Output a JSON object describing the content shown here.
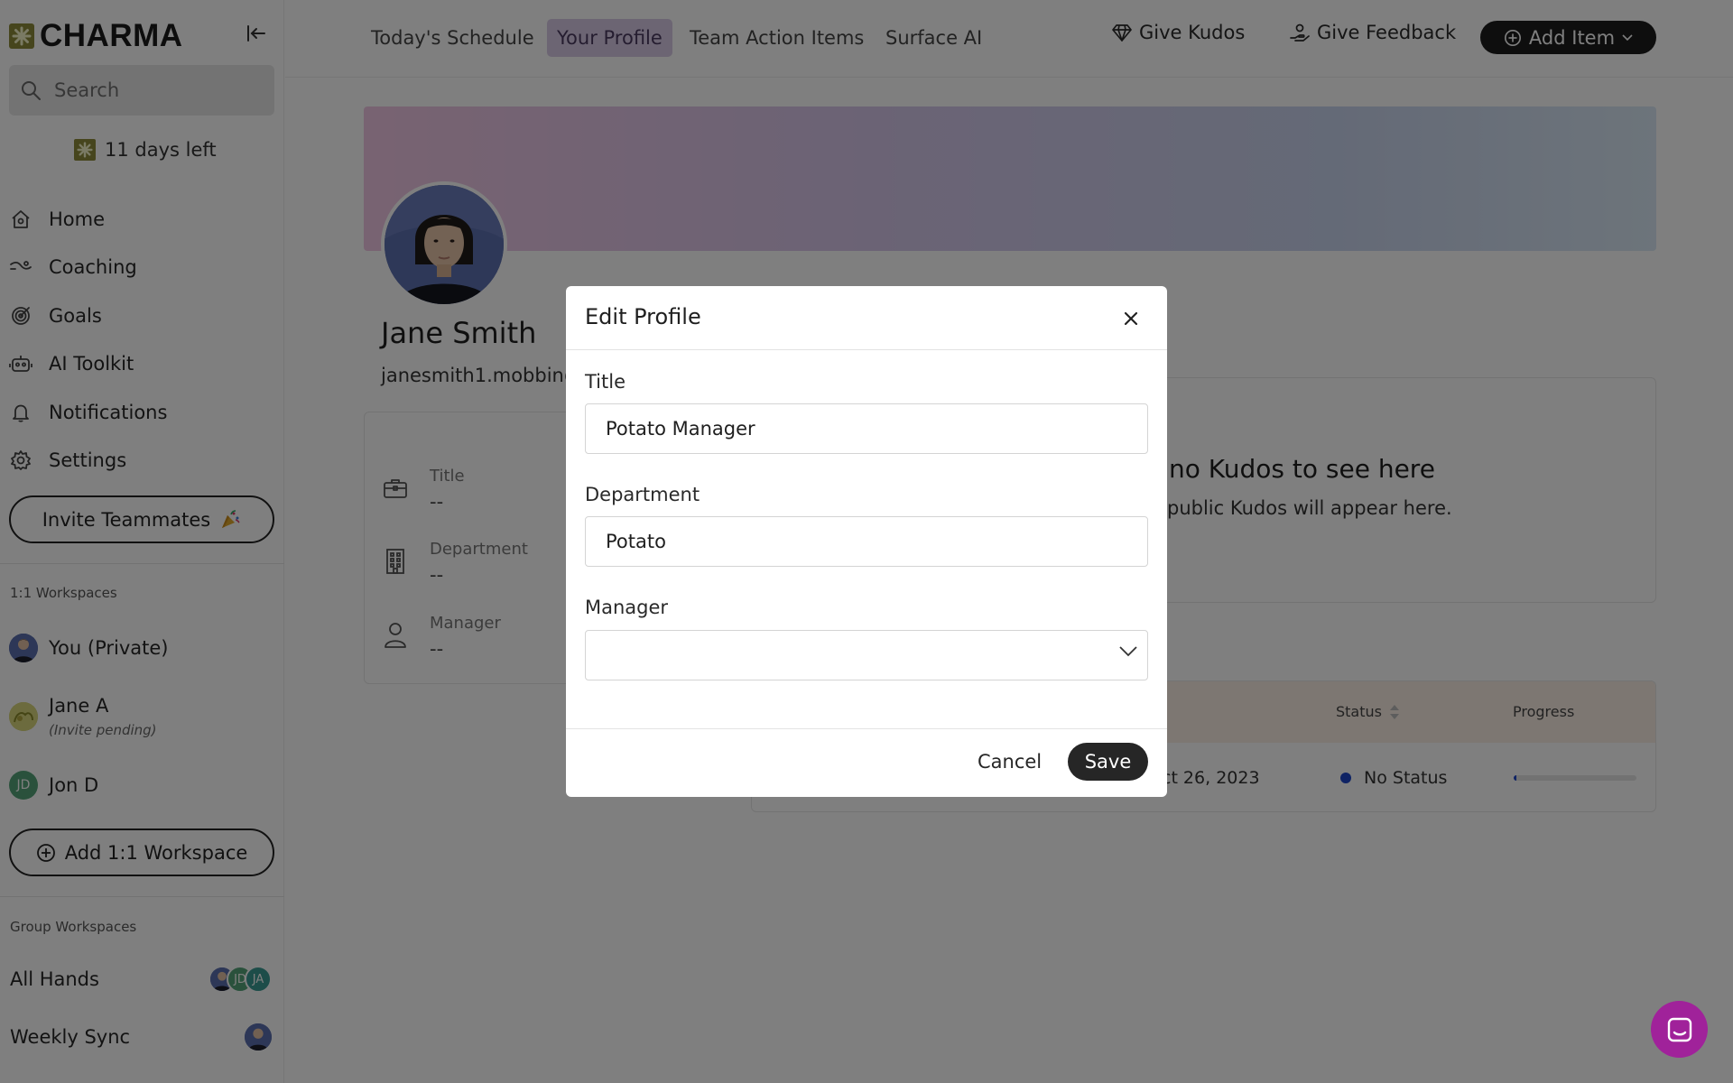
{
  "app": {
    "logo_text": "CHARMA"
  },
  "sidebar": {
    "search_placeholder": "Search",
    "trial_text": "11 days left",
    "nav": [
      {
        "label": "Home",
        "icon": "home-icon"
      },
      {
        "label": "Coaching",
        "icon": "coaching-icon"
      },
      {
        "label": "Goals",
        "icon": "target-icon"
      },
      {
        "label": "AI Toolkit",
        "icon": "robot-icon"
      },
      {
        "label": "Notifications",
        "icon": "bell-icon"
      },
      {
        "label": "Settings",
        "icon": "gear-icon"
      }
    ],
    "invite_label": "Invite Teammates",
    "one_on_one_label": "1:1 Workspaces",
    "workspaces": [
      {
        "name": "You (Private)",
        "sub": ""
      },
      {
        "name": "Jane A",
        "sub": "(Invite pending)"
      },
      {
        "name": "Jon D",
        "sub": "",
        "initials": "JD"
      }
    ],
    "add_workspace_label": "Add 1:1 Workspace",
    "group_label": "Group Workspaces",
    "groups": [
      {
        "name": "All Hands",
        "initials": [
          "JD",
          "JA"
        ]
      },
      {
        "name": "Weekly Sync"
      }
    ]
  },
  "topbar": {
    "tabs": [
      "Today's Schedule",
      "Your Profile",
      "Team Action Items",
      "Surface AI"
    ],
    "active_tab": "Your Profile",
    "give_kudos": "Give Kudos",
    "give_feedback": "Give Feedback",
    "add_item": "Add Item"
  },
  "profile": {
    "name": "Jane Smith",
    "email": "janesmith1.mobbin@",
    "fields": [
      {
        "label": "Title",
        "value": "--",
        "icon": "briefcase-icon"
      },
      {
        "label": "Department",
        "value": "--",
        "icon": "building-icon"
      },
      {
        "label": "Manager",
        "value": "--",
        "icon": "person-icon"
      }
    ]
  },
  "kudos": {
    "title": "no Kudos to see here",
    "subtitle": "public Kudos will appear here."
  },
  "goals_table": {
    "status_header": "Status",
    "progress_header": "Progress",
    "row": {
      "date": "ct 26, 2023",
      "status": "No Status",
      "progress": 0.02
    }
  },
  "modal": {
    "title": "Edit Profile",
    "title_label": "Title",
    "title_value": "Potato Manager",
    "department_label": "Department",
    "department_value": "Potato",
    "manager_label": "Manager",
    "manager_value": "",
    "cancel": "Cancel",
    "save": "Save"
  },
  "colors": {
    "accent": "#d9cbe7",
    "brand_logo": "#8d8a3a",
    "status_blue": "#1e47c8",
    "chat_bubble": "#a0229a"
  }
}
